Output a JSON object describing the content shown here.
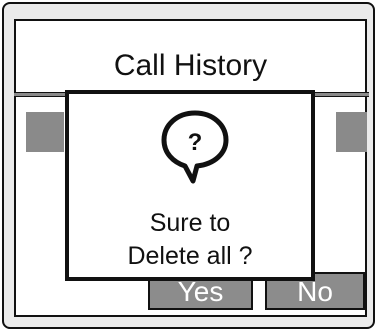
{
  "screen": {
    "title": "Call History"
  },
  "dialog": {
    "icon": "question-bubble-icon",
    "line1": "Sure to",
    "line2": "Delete all ?"
  },
  "buttons": {
    "yes_label": "Yes",
    "no_label": "No"
  },
  "colors": {
    "highlight": "#8a8a8a",
    "button_fill": "#8c8c8c",
    "border": "#111111",
    "device_bg": "#ebebeb"
  }
}
